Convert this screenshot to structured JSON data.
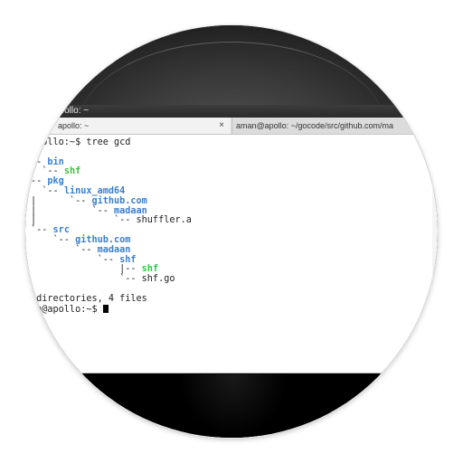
{
  "window": {
    "title": "apollo: ~",
    "ghost_title": ""
  },
  "tabs": [
    {
      "label": "apollo: ~",
      "close": "×"
    },
    {
      "label": "aman@apollo: ~/gocode/src/github.com/ma"
    }
  ],
  "terminal": {
    "lines": [
      {
        "a": "apollo:~$ tree gcd",
        "b": "",
        "c": ""
      },
      {
        "a": "",
        "b": "",
        "c": ""
      },
      {
        "a": "-- ",
        "b": "bin",
        "c": ""
      },
      {
        "a": "  `-- ",
        "b": "shf",
        "c": ""
      },
      {
        "a": "-- ",
        "b": "pkg",
        "c": ""
      },
      {
        "a": "  `-- ",
        "b": "linux_amd64",
        "c": ""
      },
      {
        "a": "|      `-- ",
        "b": "github.com",
        "c": ""
      },
      {
        "a": "|          `-- ",
        "b": "madaan",
        "c": ""
      },
      {
        "a": "|              `-- shuffler.a",
        "b": "",
        "c": ""
      },
      {
        "a": "`-- ",
        "b": "src",
        "c": ""
      },
      {
        "a": "    `-- ",
        "b": "github.com",
        "c": ""
      },
      {
        "a": "        `-- ",
        "b": "madaan",
        "c": ""
      },
      {
        "a": "            `-- ",
        "b": "shf",
        "c": ""
      },
      {
        "a": "                |-- ",
        "b": "shf",
        "c": ""
      },
      {
        "a": "                `-- shf.go",
        "b": "",
        "c": ""
      },
      {
        "a": "",
        "b": "",
        "c": ""
      },
      {
        "a": " directories, 4 files",
        "b": "",
        "c": ""
      },
      {
        "a": "an@apollo:~$ ",
        "b": "",
        "c": ""
      }
    ],
    "line_styles": [
      "",
      "",
      "dir",
      "exe",
      "dir",
      "dir",
      "dir",
      "dir",
      "",
      "dir",
      "dir",
      "dir",
      "dir",
      "exe",
      "",
      "",
      "",
      ""
    ]
  }
}
